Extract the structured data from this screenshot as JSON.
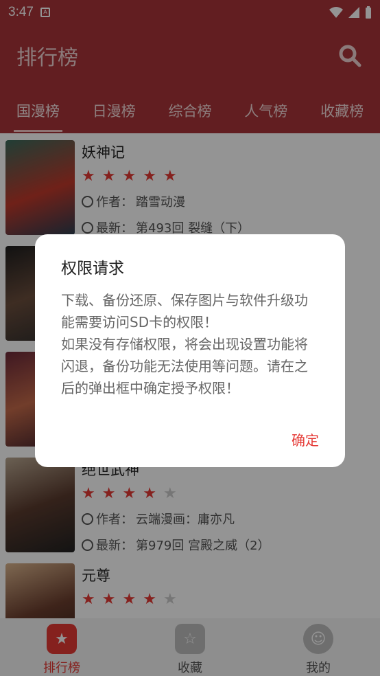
{
  "status": {
    "time": "3:47"
  },
  "appbar": {
    "title": "排行榜"
  },
  "tabs": [
    {
      "label": "国漫榜"
    },
    {
      "label": "日漫榜"
    },
    {
      "label": "综合榜"
    },
    {
      "label": "人气榜"
    },
    {
      "label": "收藏榜"
    }
  ],
  "list": [
    {
      "title": "妖神记",
      "stars": 5,
      "author_label": "作者：",
      "author": "踏雪动漫",
      "latest_label": "最新：",
      "latest": "第493回 裂缝（下）"
    },
    {
      "title": "",
      "stars": 0,
      "author_label": "",
      "author": "",
      "latest_label": "",
      "latest": ""
    },
    {
      "title": "",
      "stars": 0,
      "author_label": "",
      "author": "",
      "latest_label": "",
      "latest": ""
    },
    {
      "title": "绝世武神",
      "stars": 4,
      "author_label": "作者：",
      "author": "云端漫画：庸亦凡",
      "latest_label": "最新：",
      "latest": "第979回 宫殿之威（2）"
    },
    {
      "title": "元尊",
      "stars": 4,
      "author_label": "",
      "author": "",
      "latest_label": "",
      "latest": ""
    }
  ],
  "bottom_nav": [
    {
      "label": "排行榜"
    },
    {
      "label": "收藏"
    },
    {
      "label": "我的"
    }
  ],
  "dialog": {
    "title": "权限请求",
    "message": "下载、备份还原、保存图片与软件升级功能需要访问SD卡的权限！\n如果没有存储权限，将会出现设置功能将闪退，备份功能无法使用等问题。请在之后的弹出框中确定授予权限！",
    "confirm": "确定"
  },
  "colors": {
    "primary": "#a93539",
    "accent": "#e53935"
  }
}
